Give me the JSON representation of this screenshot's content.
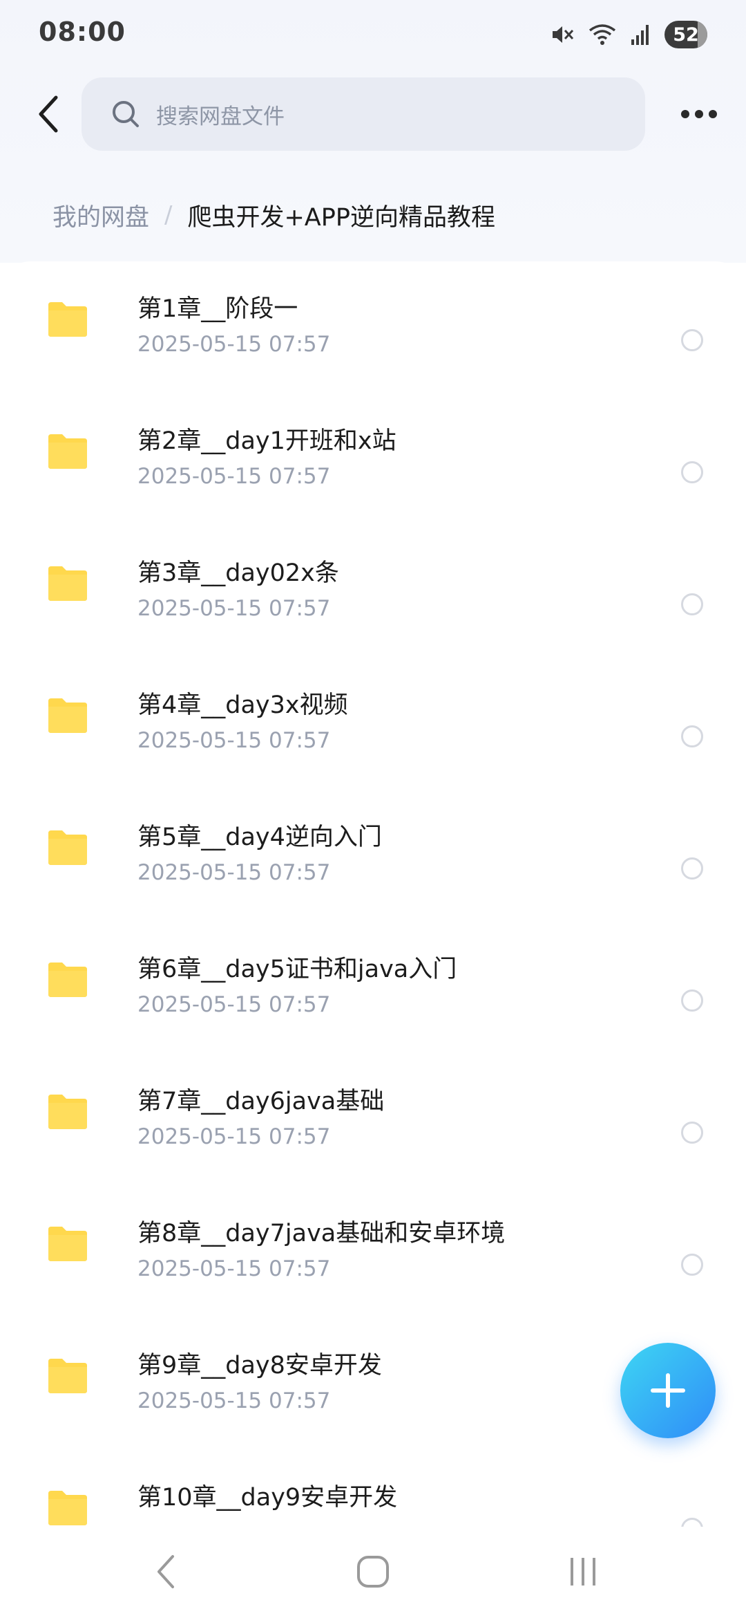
{
  "status_bar": {
    "time": "08:00",
    "icons": [
      "mute-icon",
      "wifi-icon",
      "signal-icon"
    ],
    "battery": "52"
  },
  "header": {
    "back_icon": "back-arrow-icon",
    "search_icon": "search-icon",
    "search_placeholder": "搜索网盘文件",
    "more_icon": "more-dots-icon"
  },
  "breadcrumb": {
    "root": "我的网盘",
    "separator": "/",
    "current": "爬虫开发+APP逆向精品教程"
  },
  "files": [
    {
      "name": "第1章__阶段一",
      "time": "2025-05-15  07:57"
    },
    {
      "name": "第2章__day1开班和x站",
      "time": "2025-05-15  07:57"
    },
    {
      "name": "第3章__day02x条",
      "time": "2025-05-15  07:57"
    },
    {
      "name": "第4章__day3x视频",
      "time": "2025-05-15  07:57"
    },
    {
      "name": "第5章__day4逆向入门",
      "time": "2025-05-15  07:57"
    },
    {
      "name": "第6章__day5证书和java入门",
      "time": "2025-05-15  07:57"
    },
    {
      "name": "第7章__day6java基础",
      "time": "2025-05-15  07:57"
    },
    {
      "name": "第8章__day7java基础和安卓环境",
      "time": "2025-05-15  07:57"
    },
    {
      "name": "第9章__day8安卓开发",
      "time": "2025-05-15  07:57"
    },
    {
      "name": "第10章__day9安卓开发",
      "time": ""
    }
  ],
  "colors": {
    "folder": "#FFD84D",
    "fab_start": "#3ED6F3",
    "fab_end": "#2F8CF8",
    "secondary_text": "#9AA1B0"
  },
  "fab": {
    "icon": "plus-icon"
  },
  "nav_bar": {
    "icons": [
      "nav-back-icon",
      "nav-home-icon",
      "nav-recents-icon"
    ]
  }
}
